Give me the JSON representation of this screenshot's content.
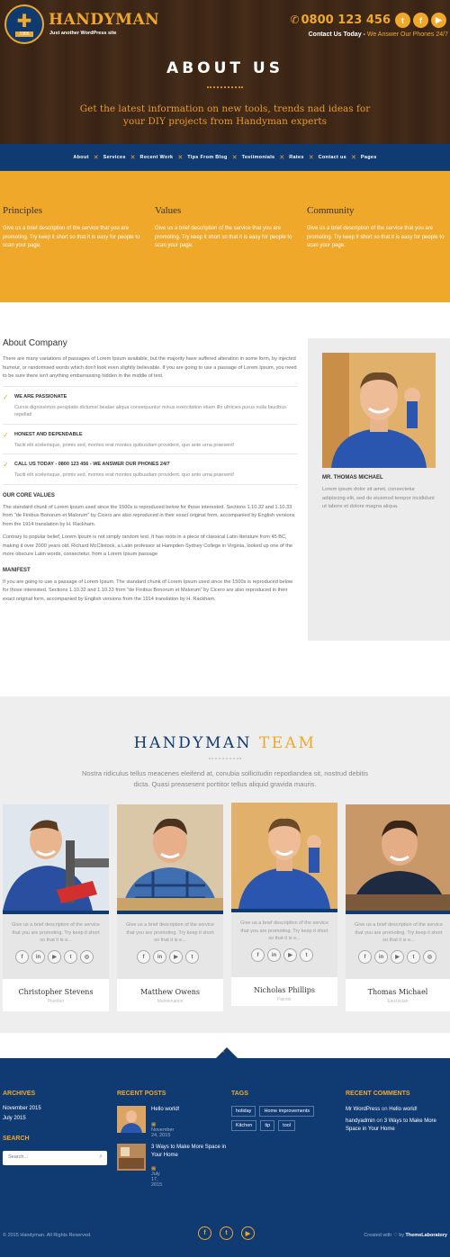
{
  "header": {
    "logo_year": "1986",
    "brand": "HANDYMAN",
    "tagline": "Just another WordPress site",
    "phone": "0800 123 456",
    "contact_today": "Contact Us Today",
    "contact_sep": " - ",
    "contact_highlight": "We Answer Our Phones 24/7",
    "social": [
      {
        "icon": "twitter-icon",
        "glyph": "t"
      },
      {
        "icon": "facebook-icon",
        "glyph": "f"
      },
      {
        "icon": "youtube-icon",
        "glyph": "▶"
      }
    ]
  },
  "hero": {
    "title": "ABOUT US",
    "subtitle": "Get the latest information on new tools, trends nad ideas for your DIY projects from Handyman experts"
  },
  "nav": {
    "items": [
      "About",
      "Services",
      "Recent Work",
      "Tips From Blog",
      "Testimonials",
      "Rates",
      "Contact us",
      "Pages"
    ]
  },
  "principles": [
    {
      "title": "Principles",
      "text": "Give us a brief description of the service that you are promoting. Try keep it short so that it is easy for people to scan your page."
    },
    {
      "title": "Values",
      "text": "Give us a brief description of the service that you are promoting. Try keep it short so that it is easy for people to scan your page."
    },
    {
      "title": "Community",
      "text": "Give us a brief description of the service that you are promoting. Try keep it short so that it is easy for people to scan your page."
    }
  ],
  "about": {
    "title": "About Company",
    "intro": "There are many variations of passages of Lorem Ipsum available, but the majority have suffered alteration in some form, by injected humour, or randomised words which don't look even slightly believable. If you are going to use a passage of Lorem Ipsum, you need to be sure there isn't anything embarrassing hidden in the middle of text.",
    "features": [
      {
        "title": "WE ARE PASSIONATE",
        "text": "Cursis dignissimos perspiatis dictumst beatae aliqua consequuntur minus exercitation etiam illo ultricies purus nulla faucibus repellat!"
      },
      {
        "title": "HONEST AND DEPENDABLE",
        "text": "Taciti elit scelerisque, primis sed, montes erat montes quibusdam provident, quo ante urna praesent!"
      },
      {
        "title": "CALL US TODAY - 0800 123 456 - WE ANSWER OUR PHONES 24/7",
        "text": "Taciti elit scelerisque, primis sed, montes erat montes quibusdam provident, quo ante urna praesent!"
      }
    ],
    "core_values_title": "OUR CORE VALUES",
    "core_values_p1": "The standard chunk of Lorem Ipsum used since the 1500s is reproduced below for those interested. Sections 1.10.32 and 1.10.33 from \"de Finibus Bonorum et Malorum\" by Cicero are also reproduced in their exact original form, accompanied by English versions from the 1914 translation by H. Rackham.",
    "core_values_p2": "Contrary to popular belief, Lorem Ipsum is not simply random text. It has roots in a piece of classical Latin literature from 45 BC, making it over 2000 years old. Richard McClintock, a Latin professor at Hampden-Sydney College in Virginia, looked up one of the more obscure Latin words, consectetur, from a Lorem Ipsum passage",
    "manifest_title": "MANIFEST",
    "manifest_text": "If you are going to use a passage of Lorem Ipsum. The standard chunk of Lorem Ipsum used since the 1500s is reproduced below for those interested. Sections 1.10.32 and 1.10.33 from \"de Finibus Bonorum et Malorum\" by Cicero are also reproduced in their exact original form, accompanied by English versions from the 1914 translation by H. Rackham."
  },
  "profile": {
    "name": "MR. THOMAS MICHAEL",
    "text": "Lorem ipsum dolor sit amet, consectetur adipiscing elit, sed do eiusmod tempor incididunt ut labore et dolore magna aliqua."
  },
  "team": {
    "title_part1": "HANDYMAN",
    "title_part2": "TEAM",
    "subtitle": "Nostra ridiculus tellus meacenes eleifend at, conubia sollicitudin repodiandea sit, nostrud debitis dicta. Quasi preasesent porttitor tellus aliquid gravida mauris.",
    "members": [
      {
        "name": "Christopher Stevens",
        "role": "Plumber",
        "desc": "Give us a brief description of the service that you are promoting. Try keep it short so that it is e..."
      },
      {
        "name": "Matthew Owens",
        "role": "Maintenance",
        "desc": "Give us a brief description of the service that you are promoting. Try keep it short so that it is e..."
      },
      {
        "name": "Nicholas Phillips",
        "role": "Painter",
        "desc": "Give us a brief description of the service that you are promoting. Try keep it short so that it is e..."
      },
      {
        "name": "Thomas Michael",
        "role": "Electrician",
        "desc": "Give us a brief description of the service that you are promoting. Try keep it short so that it is e..."
      }
    ],
    "icon_glyphs": {
      "facebook": "f",
      "linkedin": "in",
      "youtube": "▶",
      "twitter": "t",
      "instagram": "◎"
    }
  },
  "footer": {
    "archives_title": "ARCHIVES",
    "archives": [
      "November 2015",
      "July 2015"
    ],
    "search_title": "SEARCH",
    "search_placeholder": "Search...",
    "recent_posts_title": "RECENT POSTS",
    "posts": [
      {
        "title": "Hello world!",
        "date": "November 24, 2015"
      },
      {
        "title": "3 Ways to Make More Space in Your Home",
        "date": "July 17, 2015"
      }
    ],
    "tags_title": "TAGS",
    "tags": [
      "holiday",
      "Home improvements",
      "Kitchen",
      "tip",
      "tool"
    ],
    "comments_title": "RECENT COMMENTS",
    "comments": [
      {
        "author": "Mr WordPress",
        "on": "on",
        "post": "Hello world!"
      },
      {
        "author": "handyadmin",
        "on": "on",
        "post": "3 Ways to Make More Space in Your Home"
      }
    ],
    "copyright": "© 2015 Handyman. All Rights Reserved.",
    "credits_prefix": "Created with",
    "credits_by": "by",
    "credits_name": "ThemeLaboratory"
  },
  "colors": {
    "accent": "#f0a82b",
    "navy": "#103a72"
  }
}
